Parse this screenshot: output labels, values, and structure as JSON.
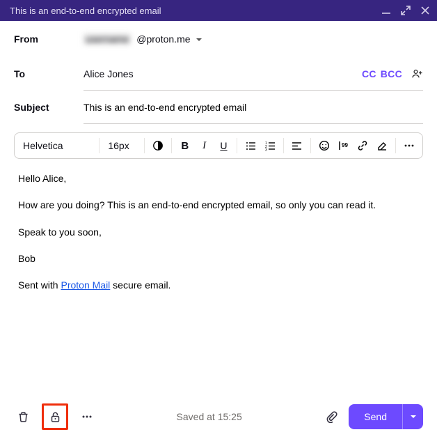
{
  "titlebar": {
    "title": "This is an end-to-end encrypted email"
  },
  "fields": {
    "from_label": "From",
    "from_user": "username",
    "from_domain": "@proton.me",
    "to_label": "To",
    "to_value": "Alice Jones",
    "cc_label": "CC",
    "bcc_label": "BCC",
    "subject_label": "Subject",
    "subject_value": "This is an end-to-end encrypted email"
  },
  "toolbar": {
    "font": "Helvetica",
    "size": "16px"
  },
  "body": {
    "p1": "Hello Alice,",
    "p2": "How are you doing? This is an end-to-end encrypted email, so only you can read it.",
    "p3": "Speak to you soon,",
    "p4": "Bob",
    "sig_prefix": "Sent with ",
    "sig_link": "Proton Mail",
    "sig_suffix": " secure email."
  },
  "footer": {
    "saved": "Saved at 15:25",
    "send": "Send"
  }
}
